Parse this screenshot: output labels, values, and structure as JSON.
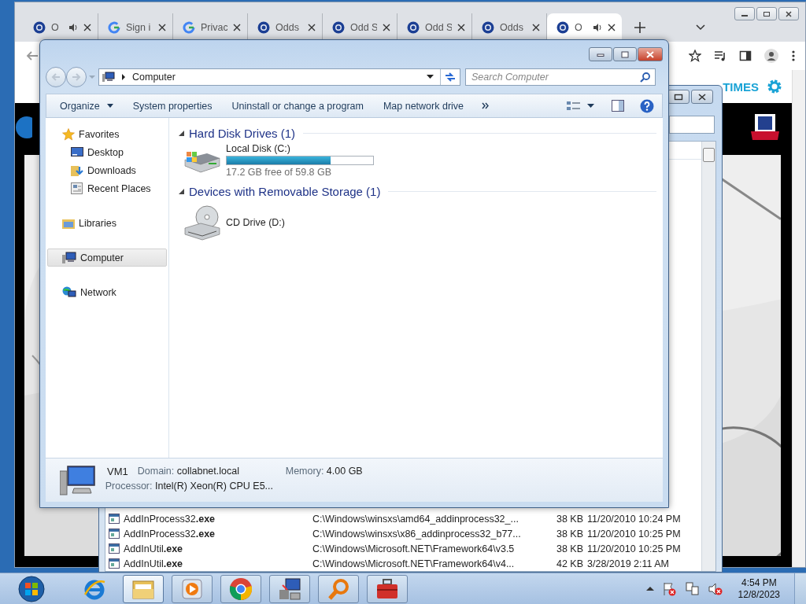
{
  "browser": {
    "tabs": [
      {
        "label": "O",
        "kind": "pbs",
        "audio": true,
        "selected": false
      },
      {
        "label": "Sign i",
        "kind": "google",
        "audio": false,
        "selected": false
      },
      {
        "label": "Privac",
        "kind": "google",
        "audio": false,
        "selected": false
      },
      {
        "label": "Odds",
        "kind": "pbs",
        "audio": false,
        "selected": false
      },
      {
        "label": "Odd S",
        "kind": "pbs",
        "audio": false,
        "selected": false
      },
      {
        "label": "Odd S",
        "kind": "pbs",
        "audio": false,
        "selected": false
      },
      {
        "label": "Odds",
        "kind": "pbs",
        "audio": false,
        "selected": false
      },
      {
        "label": "O",
        "kind": "pbs",
        "audio": true,
        "selected": true
      }
    ],
    "page": {
      "header": "TIMES"
    }
  },
  "search_window": {
    "rows": [
      {
        "name": "AddInProcess32**.exe**",
        "path": "C:\\Windows\\winsxs\\amd64_addinprocess32_...",
        "size": "38 KB",
        "modified": "11/20/2010 10:24 PM"
      },
      {
        "name": "AddInProcess32**.exe**",
        "path": "C:\\Windows\\winsxs\\x86_addinprocess32_b77...",
        "size": "38 KB",
        "modified": "11/20/2010 10:25 PM"
      },
      {
        "name": "AddInUtil**.exe**",
        "path": "C:\\Windows\\Microsoft.NET\\Framework64\\v3.5",
        "size": "38 KB",
        "modified": "11/20/2010 10:25 PM"
      },
      {
        "name": "AddInUtil**.exe**",
        "path": "C:\\Windows\\Microsoft.NET\\Framework64\\v4...",
        "size": "42 KB",
        "modified": "3/28/2019 2:11 AM"
      }
    ]
  },
  "explorer": {
    "address": "Computer",
    "search": {
      "placeholder": "Search Computer"
    },
    "commands": [
      {
        "label": "Organize",
        "menu": true
      },
      {
        "label": "System properties",
        "menu": false
      },
      {
        "label": "Uninstall or change a program",
        "menu": false
      },
      {
        "label": "Map network drive",
        "menu": false
      }
    ],
    "nav": [
      {
        "label": "Favorites",
        "kind": "star",
        "selected": false,
        "children": [
          {
            "label": "Desktop",
            "kind": "desktop",
            "selected": false
          },
          {
            "label": "Downloads",
            "kind": "downloads",
            "selected": false
          },
          {
            "label": "Recent Places",
            "kind": "recent",
            "selected": false
          }
        ]
      },
      {
        "label": "Libraries",
        "kind": "libraries",
        "selected": false
      },
      {
        "label": "Computer",
        "kind": "computer",
        "selected": true
      },
      {
        "label": "Network",
        "kind": "network",
        "selected": false
      }
    ],
    "groups": [
      {
        "title": "Hard Disk Drives (1)",
        "items": [
          {
            "name": "Local Disk (C:)",
            "kind": "hdd",
            "level": 0.71,
            "reading": "17.2 GB free of 59.8 GB"
          }
        ]
      },
      {
        "title": "Devices with Removable Storage (1)",
        "items": [
          {
            "name": "CD Drive (D:)",
            "kind": "cd"
          }
        ]
      }
    ],
    "details": {
      "name": "VM1",
      "fields": [
        {
          "label": "Domain:",
          "value": "collabnet.local"
        },
        {
          "label": "Memory:",
          "value": "4.00 GB"
        },
        {
          "label": "Processor:",
          "value": "Intel(R) Xeon(R) CPU E5..."
        }
      ]
    }
  },
  "taskbar": {
    "apps": [
      {
        "kind": "ie",
        "running": false,
        "active": false
      },
      {
        "kind": "folder",
        "running": true,
        "active": true
      },
      {
        "kind": "media",
        "running": true,
        "active": false
      },
      {
        "kind": "chrome",
        "running": true,
        "active": false
      },
      {
        "kind": "netprog",
        "running": true,
        "active": false
      },
      {
        "kind": "magnifier",
        "running": true,
        "active": false
      },
      {
        "kind": "toolbox",
        "running": true,
        "active": false
      }
    ],
    "clock": {
      "time": "4:54 PM",
      "date": "12/8/2023"
    }
  }
}
